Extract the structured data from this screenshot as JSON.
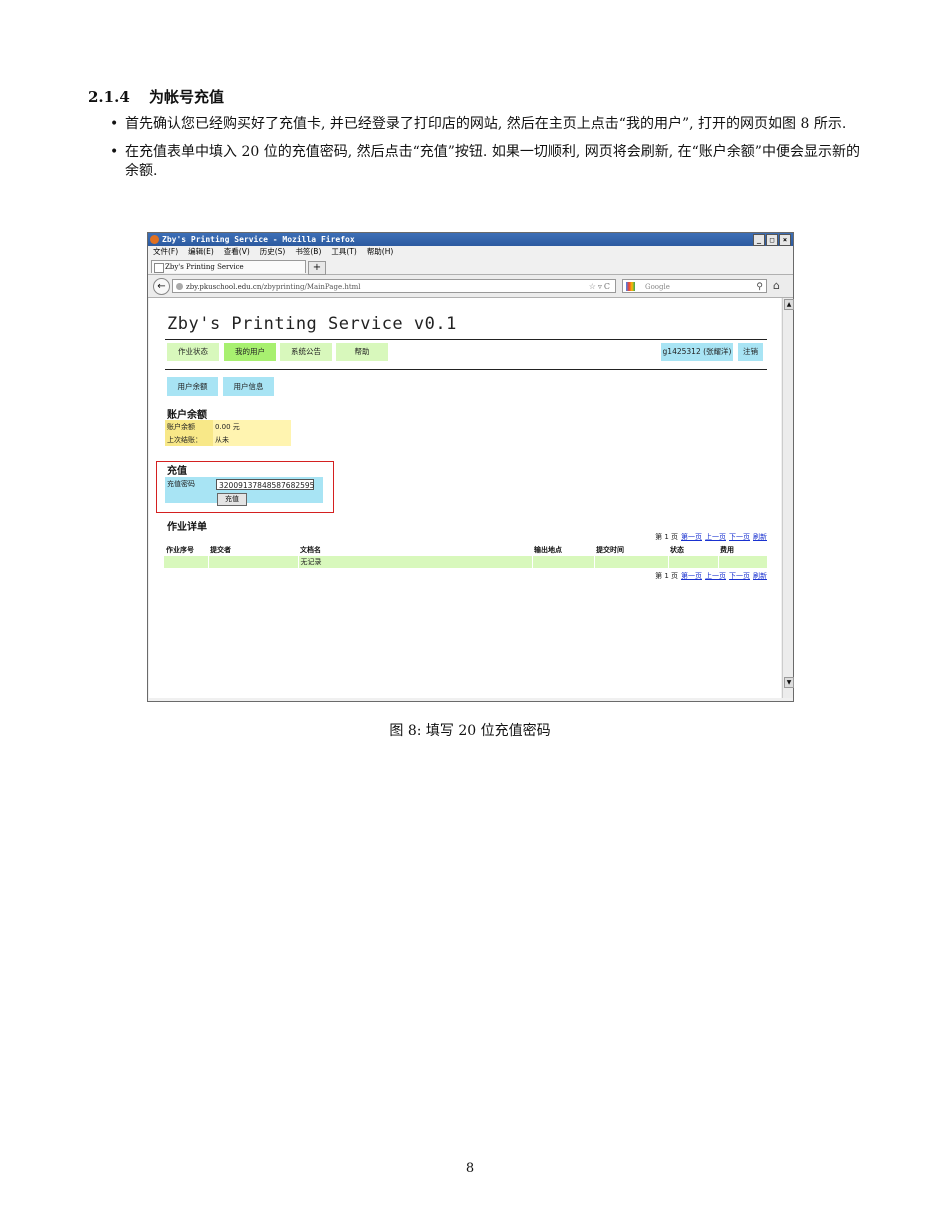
{
  "section": {
    "number": "2.1.4",
    "title": "为帐号充值",
    "bullets": [
      "首先确认您已经购买好了充值卡, 并已经登录了打印店的网站, 然后在主页上点击“我的用户”, 打开的网页如图 8 所示.",
      "在充值表单中填入 20 位的充值密码, 然后点击“充值”按钮. 如果一切顺利, 网页将会刷新, 在“账户余额”中便会显示新的余额."
    ]
  },
  "screenshot": {
    "window_title": "Zby's Printing Service - Mozilla Firefox",
    "window_controls": [
      "_",
      "□",
      "×"
    ],
    "menu": [
      "文件(F)",
      "编辑(E)",
      "查看(V)",
      "历史(S)",
      "书签(B)",
      "工具(T)",
      "帮助(H)"
    ],
    "tab_title": "Zby's Printing Service",
    "tab_add": "+",
    "url_host": "zby.pkuschool.edu.cn",
    "url_path": "/zbyprinting/MainPage.html",
    "url_prefix": "",
    "search_placeholder": "Google",
    "page": {
      "title": "Zby's Printing Service v0.1",
      "nav": [
        "作业状态",
        "我的用户",
        "系统公告",
        "帮助"
      ],
      "user_label": "g1425312 (张耀洋)",
      "logout": "注销",
      "subtabs": [
        "用户余额",
        "用户信息"
      ],
      "balance_heading": "账户余额",
      "balance_rows": [
        {
          "label": "账户余额",
          "value": "0.00 元"
        },
        {
          "label": "上次结账：",
          "value": "从未"
        }
      ],
      "charge_heading": "充值",
      "charge_label": "充值密码",
      "charge_value": "32009137848587682595",
      "charge_button": "充值",
      "jobs_heading": "作业详单",
      "pager": {
        "prefix": "第 1 页",
        "links": [
          "第一页",
          "上一页",
          "下一页",
          "刷新"
        ]
      },
      "jobs_columns": [
        "作业序号",
        "提交者",
        "文档名",
        "输出地点",
        "提交时间",
        "状态",
        "费用"
      ],
      "jobs_empty": "无记录"
    }
  },
  "caption": "图 8: 填写 20 位充值密码",
  "page_number": "8",
  "colors": {
    "nav_tab": "#d8f8bc",
    "nav_tab_active": "#a8f070",
    "subtab": "#a8e4f4",
    "balance_label": "#f8e888",
    "balance_value": "#fff4b0",
    "charge_label": "#a8e4f4",
    "highlight_box": "#d42020"
  }
}
